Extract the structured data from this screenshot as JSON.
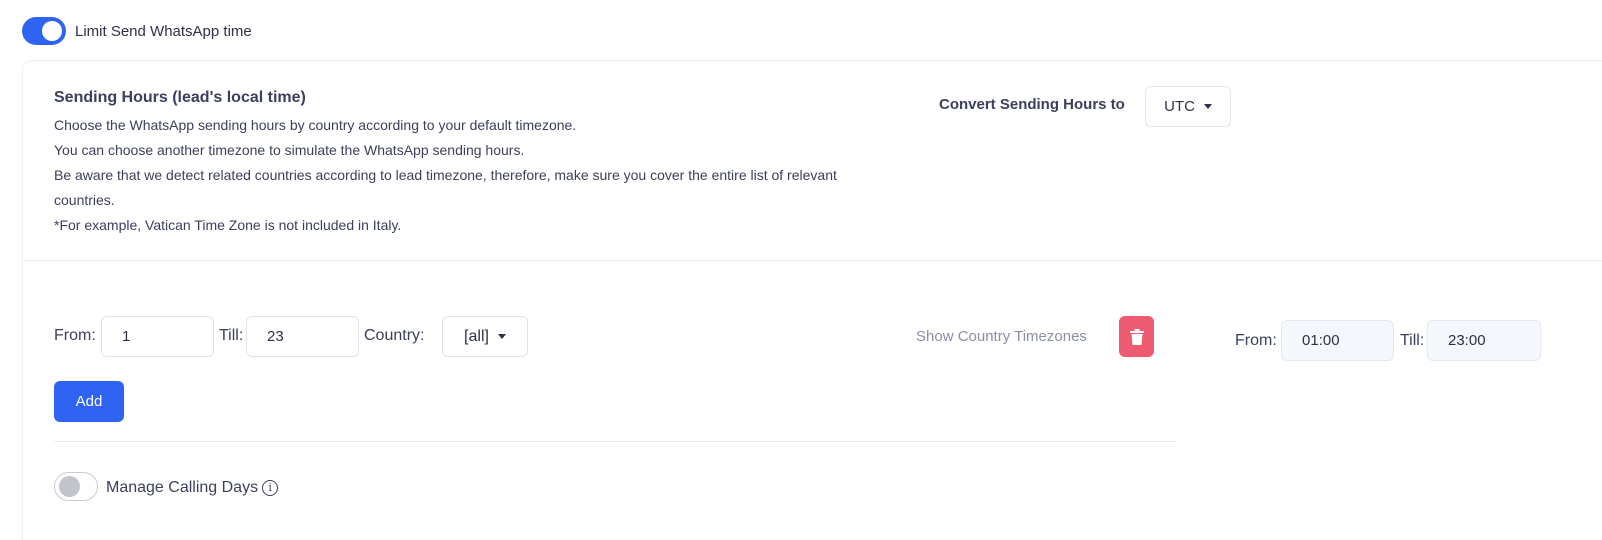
{
  "top_toggle": {
    "label": "Limit Send WhatsApp time",
    "enabled": true
  },
  "header": {
    "title": "Sending Hours (lead's local time)",
    "lines": [
      "Choose the WhatsApp sending hours by country according to your default timezone.",
      "You can choose another timezone to simulate the WhatsApp sending hours.",
      "Be aware that we detect related countries according to lead timezone, therefore, make sure you cover the entire list of relevant countries.",
      "*For example, Vatican Time Zone is not included in Italy."
    ]
  },
  "convert": {
    "label": "Convert Sending Hours to",
    "timezone": "UTC"
  },
  "rule_row": {
    "from_label": "From:",
    "from_value": "1",
    "till_label": "Till:",
    "till_value": "23",
    "country_label": "Country:",
    "country_value": "[all]",
    "show_timezones_label": "Show Country Timezones"
  },
  "converted": {
    "from_label": "From:",
    "from_value": "01:00",
    "till_label": "Till:",
    "till_value": "23:00"
  },
  "add_button": {
    "label": "Add"
  },
  "calling_days": {
    "label": "Manage Calling Days",
    "enabled": false
  },
  "colors": {
    "primary": "#2f64f2",
    "danger": "#ee5a6f",
    "text": "#3b3f5c",
    "muted": "#8a8fa6"
  },
  "icons": {
    "trash": "trash-icon",
    "info": "info-icon",
    "caret": "caret-down-icon"
  }
}
